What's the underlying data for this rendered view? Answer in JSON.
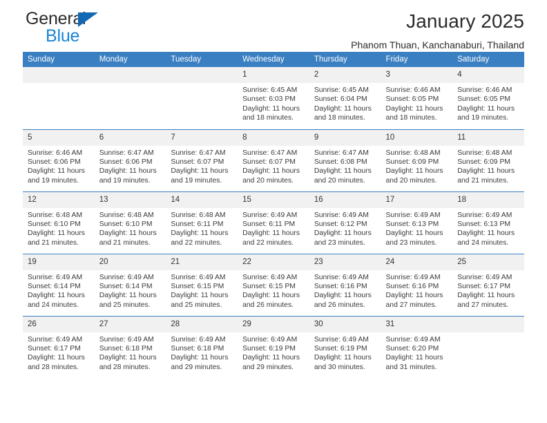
{
  "brand": {
    "name_part1": "General",
    "name_part2": "Blue",
    "color_dark": "#2b2b2b",
    "color_blue": "#1884d6"
  },
  "header": {
    "title": "January 2025",
    "location": "Phanom Thuan, Kanchanaburi, Thailand"
  },
  "theme": {
    "header_bar": "#3a7fc1",
    "daynum_strip": "#f1f1f1",
    "text": "#3a3a3a"
  },
  "weekdays": [
    "Sunday",
    "Monday",
    "Tuesday",
    "Wednesday",
    "Thursday",
    "Friday",
    "Saturday"
  ],
  "labels": {
    "sunrise": "Sunrise:",
    "sunset": "Sunset:",
    "daylight": "Daylight:"
  },
  "weeks": [
    [
      {
        "day": "",
        "sunrise": "",
        "sunset": "",
        "daylight_line1": "",
        "daylight_line2": ""
      },
      {
        "day": "",
        "sunrise": "",
        "sunset": "",
        "daylight_line1": "",
        "daylight_line2": ""
      },
      {
        "day": "",
        "sunrise": "",
        "sunset": "",
        "daylight_line1": "",
        "daylight_line2": ""
      },
      {
        "day": "1",
        "sunrise": "Sunrise: 6:45 AM",
        "sunset": "Sunset: 6:03 PM",
        "daylight_line1": "Daylight: 11 hours",
        "daylight_line2": "and 18 minutes."
      },
      {
        "day": "2",
        "sunrise": "Sunrise: 6:45 AM",
        "sunset": "Sunset: 6:04 PM",
        "daylight_line1": "Daylight: 11 hours",
        "daylight_line2": "and 18 minutes."
      },
      {
        "day": "3",
        "sunrise": "Sunrise: 6:46 AM",
        "sunset": "Sunset: 6:05 PM",
        "daylight_line1": "Daylight: 11 hours",
        "daylight_line2": "and 18 minutes."
      },
      {
        "day": "4",
        "sunrise": "Sunrise: 6:46 AM",
        "sunset": "Sunset: 6:05 PM",
        "daylight_line1": "Daylight: 11 hours",
        "daylight_line2": "and 19 minutes."
      }
    ],
    [
      {
        "day": "5",
        "sunrise": "Sunrise: 6:46 AM",
        "sunset": "Sunset: 6:06 PM",
        "daylight_line1": "Daylight: 11 hours",
        "daylight_line2": "and 19 minutes."
      },
      {
        "day": "6",
        "sunrise": "Sunrise: 6:47 AM",
        "sunset": "Sunset: 6:06 PM",
        "daylight_line1": "Daylight: 11 hours",
        "daylight_line2": "and 19 minutes."
      },
      {
        "day": "7",
        "sunrise": "Sunrise: 6:47 AM",
        "sunset": "Sunset: 6:07 PM",
        "daylight_line1": "Daylight: 11 hours",
        "daylight_line2": "and 19 minutes."
      },
      {
        "day": "8",
        "sunrise": "Sunrise: 6:47 AM",
        "sunset": "Sunset: 6:07 PM",
        "daylight_line1": "Daylight: 11 hours",
        "daylight_line2": "and 20 minutes."
      },
      {
        "day": "9",
        "sunrise": "Sunrise: 6:47 AM",
        "sunset": "Sunset: 6:08 PM",
        "daylight_line1": "Daylight: 11 hours",
        "daylight_line2": "and 20 minutes."
      },
      {
        "day": "10",
        "sunrise": "Sunrise: 6:48 AM",
        "sunset": "Sunset: 6:09 PM",
        "daylight_line1": "Daylight: 11 hours",
        "daylight_line2": "and 20 minutes."
      },
      {
        "day": "11",
        "sunrise": "Sunrise: 6:48 AM",
        "sunset": "Sunset: 6:09 PM",
        "daylight_line1": "Daylight: 11 hours",
        "daylight_line2": "and 21 minutes."
      }
    ],
    [
      {
        "day": "12",
        "sunrise": "Sunrise: 6:48 AM",
        "sunset": "Sunset: 6:10 PM",
        "daylight_line1": "Daylight: 11 hours",
        "daylight_line2": "and 21 minutes."
      },
      {
        "day": "13",
        "sunrise": "Sunrise: 6:48 AM",
        "sunset": "Sunset: 6:10 PM",
        "daylight_line1": "Daylight: 11 hours",
        "daylight_line2": "and 21 minutes."
      },
      {
        "day": "14",
        "sunrise": "Sunrise: 6:48 AM",
        "sunset": "Sunset: 6:11 PM",
        "daylight_line1": "Daylight: 11 hours",
        "daylight_line2": "and 22 minutes."
      },
      {
        "day": "15",
        "sunrise": "Sunrise: 6:49 AM",
        "sunset": "Sunset: 6:11 PM",
        "daylight_line1": "Daylight: 11 hours",
        "daylight_line2": "and 22 minutes."
      },
      {
        "day": "16",
        "sunrise": "Sunrise: 6:49 AM",
        "sunset": "Sunset: 6:12 PM",
        "daylight_line1": "Daylight: 11 hours",
        "daylight_line2": "and 23 minutes."
      },
      {
        "day": "17",
        "sunrise": "Sunrise: 6:49 AM",
        "sunset": "Sunset: 6:13 PM",
        "daylight_line1": "Daylight: 11 hours",
        "daylight_line2": "and 23 minutes."
      },
      {
        "day": "18",
        "sunrise": "Sunrise: 6:49 AM",
        "sunset": "Sunset: 6:13 PM",
        "daylight_line1": "Daylight: 11 hours",
        "daylight_line2": "and 24 minutes."
      }
    ],
    [
      {
        "day": "19",
        "sunrise": "Sunrise: 6:49 AM",
        "sunset": "Sunset: 6:14 PM",
        "daylight_line1": "Daylight: 11 hours",
        "daylight_line2": "and 24 minutes."
      },
      {
        "day": "20",
        "sunrise": "Sunrise: 6:49 AM",
        "sunset": "Sunset: 6:14 PM",
        "daylight_line1": "Daylight: 11 hours",
        "daylight_line2": "and 25 minutes."
      },
      {
        "day": "21",
        "sunrise": "Sunrise: 6:49 AM",
        "sunset": "Sunset: 6:15 PM",
        "daylight_line1": "Daylight: 11 hours",
        "daylight_line2": "and 25 minutes."
      },
      {
        "day": "22",
        "sunrise": "Sunrise: 6:49 AM",
        "sunset": "Sunset: 6:15 PM",
        "daylight_line1": "Daylight: 11 hours",
        "daylight_line2": "and 26 minutes."
      },
      {
        "day": "23",
        "sunrise": "Sunrise: 6:49 AM",
        "sunset": "Sunset: 6:16 PM",
        "daylight_line1": "Daylight: 11 hours",
        "daylight_line2": "and 26 minutes."
      },
      {
        "day": "24",
        "sunrise": "Sunrise: 6:49 AM",
        "sunset": "Sunset: 6:16 PM",
        "daylight_line1": "Daylight: 11 hours",
        "daylight_line2": "and 27 minutes."
      },
      {
        "day": "25",
        "sunrise": "Sunrise: 6:49 AM",
        "sunset": "Sunset: 6:17 PM",
        "daylight_line1": "Daylight: 11 hours",
        "daylight_line2": "and 27 minutes."
      }
    ],
    [
      {
        "day": "26",
        "sunrise": "Sunrise: 6:49 AM",
        "sunset": "Sunset: 6:17 PM",
        "daylight_line1": "Daylight: 11 hours",
        "daylight_line2": "and 28 minutes."
      },
      {
        "day": "27",
        "sunrise": "Sunrise: 6:49 AM",
        "sunset": "Sunset: 6:18 PM",
        "daylight_line1": "Daylight: 11 hours",
        "daylight_line2": "and 28 minutes."
      },
      {
        "day": "28",
        "sunrise": "Sunrise: 6:49 AM",
        "sunset": "Sunset: 6:18 PM",
        "daylight_line1": "Daylight: 11 hours",
        "daylight_line2": "and 29 minutes."
      },
      {
        "day": "29",
        "sunrise": "Sunrise: 6:49 AM",
        "sunset": "Sunset: 6:19 PM",
        "daylight_line1": "Daylight: 11 hours",
        "daylight_line2": "and 29 minutes."
      },
      {
        "day": "30",
        "sunrise": "Sunrise: 6:49 AM",
        "sunset": "Sunset: 6:19 PM",
        "daylight_line1": "Daylight: 11 hours",
        "daylight_line2": "and 30 minutes."
      },
      {
        "day": "31",
        "sunrise": "Sunrise: 6:49 AM",
        "sunset": "Sunset: 6:20 PM",
        "daylight_line1": "Daylight: 11 hours",
        "daylight_line2": "and 31 minutes."
      },
      {
        "day": "",
        "sunrise": "",
        "sunset": "",
        "daylight_line1": "",
        "daylight_line2": ""
      }
    ]
  ]
}
